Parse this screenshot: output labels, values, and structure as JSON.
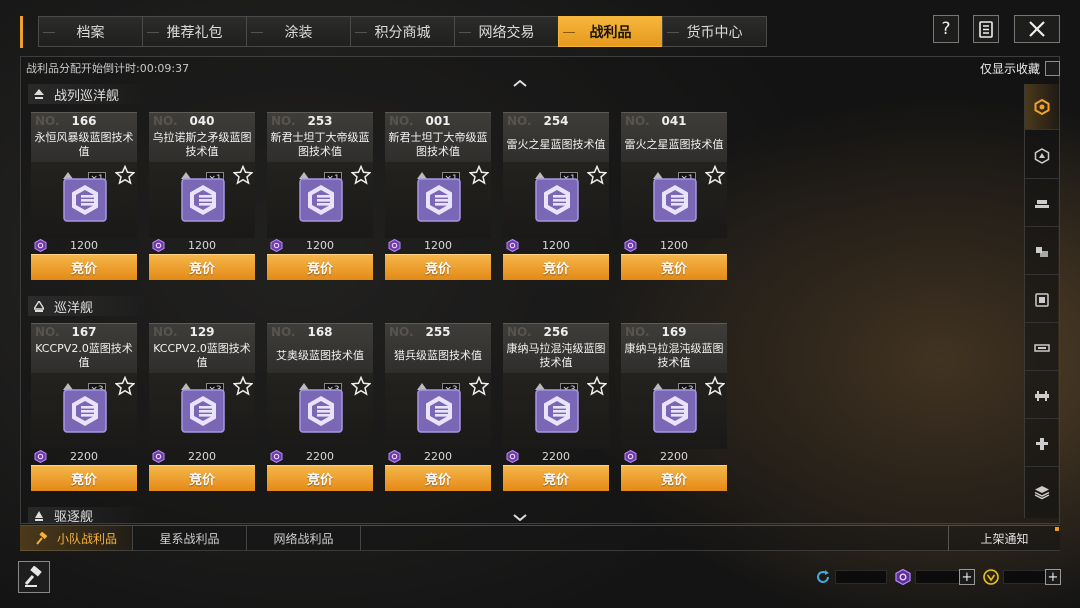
{
  "top_tabs": [
    "档案",
    "推荐礼包",
    "涂装",
    "积分商城",
    "网络交易",
    "战利品",
    "货币中心"
  ],
  "active_tab": "战利品",
  "toolbar": {
    "help_label": "?"
  },
  "countdown_text": "战利品分配开始倒计时:00:09:37",
  "only_favorites_label": "仅显示收藏",
  "sections": [
    {
      "title": "战列巡洋舰",
      "cards": [
        {
          "no_label": "NO.",
          "number": "166",
          "title": "永恒风暴级蓝图技术值",
          "qty": "×1",
          "price": "1200",
          "bid_label": "竞价"
        },
        {
          "no_label": "NO.",
          "number": "040",
          "title": "乌拉诺斯之矛级蓝图技术值",
          "qty": "×1",
          "price": "1200",
          "bid_label": "竞价"
        },
        {
          "no_label": "NO.",
          "number": "253",
          "title": "新君士坦丁大帝级蓝图技术值",
          "qty": "×1",
          "price": "1200",
          "bid_label": "竞价"
        },
        {
          "no_label": "NO.",
          "number": "001",
          "title": "新君士坦丁大帝级蓝图技术值",
          "qty": "×1",
          "price": "1200",
          "bid_label": "竞价"
        },
        {
          "no_label": "NO.",
          "number": "254",
          "title": "雷火之星蓝图技术值",
          "qty": "×1",
          "price": "1200",
          "bid_label": "竞价"
        },
        {
          "no_label": "NO.",
          "number": "041",
          "title": "雷火之星蓝图技术值",
          "qty": "×1",
          "price": "1200",
          "bid_label": "竞价"
        }
      ]
    },
    {
      "title": "巡洋舰",
      "cards": [
        {
          "no_label": "NO.",
          "number": "167",
          "title": "KCCPV2.0蓝图技术值",
          "qty": "×3",
          "price": "2200",
          "bid_label": "竞价"
        },
        {
          "no_label": "NO.",
          "number": "129",
          "title": "KCCPV2.0蓝图技术值",
          "qty": "×3",
          "price": "2200",
          "bid_label": "竞价"
        },
        {
          "no_label": "NO.",
          "number": "168",
          "title": "艾奥级蓝图技术值",
          "qty": "×3",
          "price": "2200",
          "bid_label": "竞价"
        },
        {
          "no_label": "NO.",
          "number": "255",
          "title": "猎兵级蓝图技术值",
          "qty": "×3",
          "price": "2200",
          "bid_label": "竞价"
        },
        {
          "no_label": "NO.",
          "number": "256",
          "title": "康纳马拉混沌级蓝图技术值",
          "qty": "×3",
          "price": "2200",
          "bid_label": "竞价"
        },
        {
          "no_label": "NO.",
          "number": "169",
          "title": "康纳马拉混沌级蓝图技术值",
          "qty": "×3",
          "price": "2200",
          "bid_label": "竞价"
        }
      ]
    },
    {
      "title": "驱逐舰",
      "cards": []
    }
  ],
  "side_icons": [
    "filter-all-icon",
    "battlecruiser-icon",
    "cruiser-icon",
    "destroyer-icon",
    "frigate-icon",
    "carrier-icon",
    "corvette-icon",
    "aircraft-icon",
    "materials-icon"
  ],
  "bottom_tabs": [
    "小队战利品",
    "星系战利品",
    "网络战利品"
  ],
  "active_bottom_tab": "小队战利品",
  "listing_notice_label": "上架通知",
  "plus_label": "+",
  "colors": {
    "accent": "#f0a12a",
    "bid_button": "#e8921c",
    "blueprint": "#7a68b6"
  }
}
